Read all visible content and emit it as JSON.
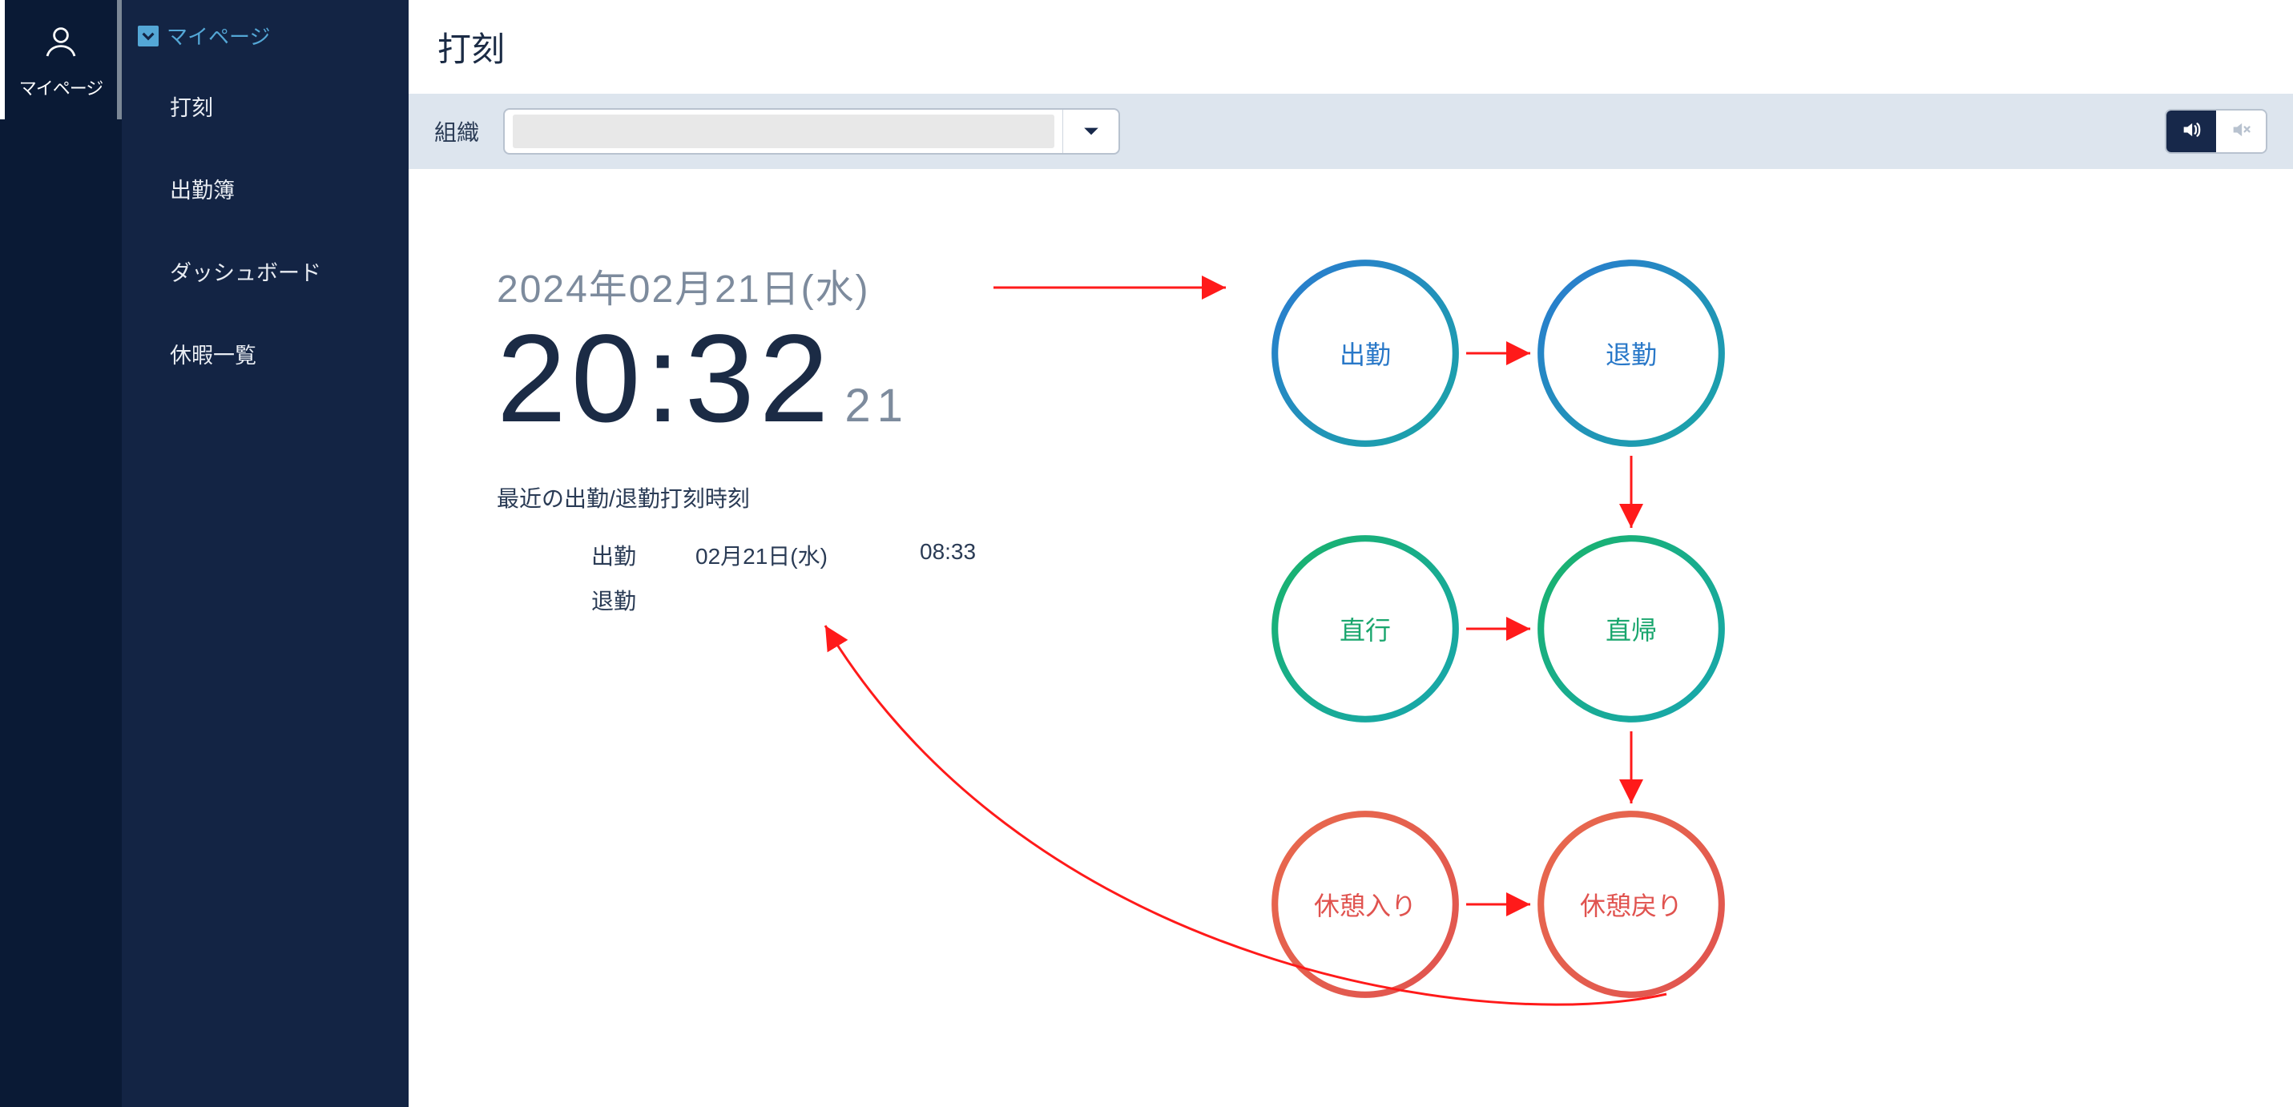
{
  "rail": {
    "mypage_label": "マイページ"
  },
  "submenu": {
    "title": "マイページ",
    "items": [
      {
        "label": "打刻"
      },
      {
        "label": "出勤簿"
      },
      {
        "label": "ダッシュボード"
      },
      {
        "label": "休暇一覧"
      }
    ]
  },
  "page": {
    "title": "打刻"
  },
  "filter": {
    "org_label": "組織",
    "org_value": ""
  },
  "clock": {
    "date": "2024年02月21日(水)",
    "time": "20:32",
    "seconds": "21"
  },
  "recent": {
    "heading": "最近の出勤/退勤打刻時刻",
    "rows": [
      {
        "kind": "出勤",
        "date": "02月21日(水)",
        "time": "08:33"
      },
      {
        "kind": "退勤",
        "date": "",
        "time": ""
      }
    ]
  },
  "buttons": {
    "clock_in": "出勤",
    "clock_out": "退勤",
    "direct_go": "直行",
    "direct_back": "直帰",
    "break_start": "休憩入り",
    "break_end": "休憩戻り"
  }
}
